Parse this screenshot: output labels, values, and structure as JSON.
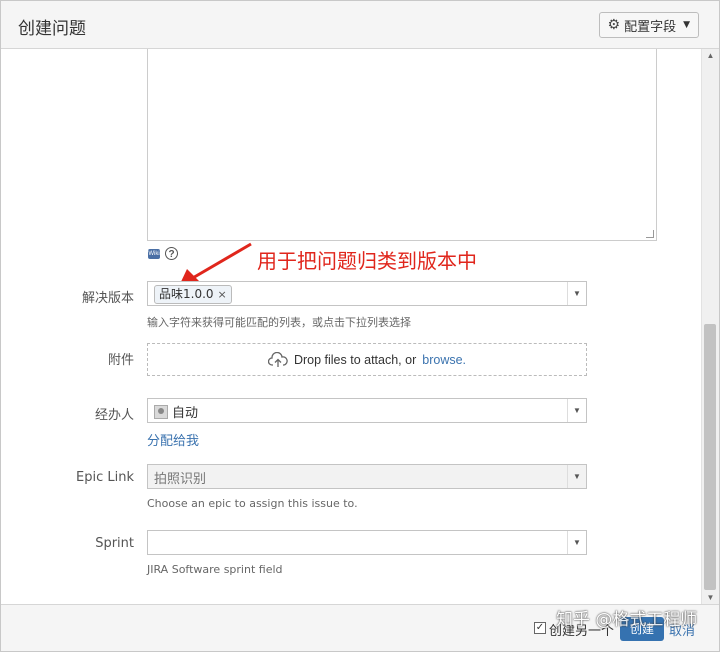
{
  "header": {
    "title": "创建问题",
    "config_button": "配置字段"
  },
  "description": {
    "wiki_icon": "Wiki"
  },
  "annotation": {
    "text": "用于把问题归类到版本中",
    "color": "#e0261c"
  },
  "fix_version": {
    "label": "解决版本",
    "tag_value": "品味1.0.0",
    "remove_glyph": "×",
    "hint": "输入字符来获得可能匹配的列表，或点击下拉列表选择"
  },
  "attachment": {
    "label": "附件",
    "drop_text": "Drop files to attach, or",
    "browse_link": "browse."
  },
  "assignee": {
    "label": "经办人",
    "value": "自动",
    "assign_to_me": "分配给我"
  },
  "epic_link": {
    "label": "Epic Link",
    "value": "拍照识别",
    "hint": "Choose an epic to assign this issue to."
  },
  "sprint": {
    "label": "Sprint",
    "value": "",
    "hint": "JIRA Software sprint field"
  },
  "footer": {
    "create_another_label": "创建另一个",
    "create_button": "创建",
    "cancel_link": "取消"
  },
  "watermark": "知乎 @格式工程师",
  "colors": {
    "accent_link": "#3b73af",
    "primary_button": "#3572b0",
    "header_bg": "#f5f5f5"
  }
}
